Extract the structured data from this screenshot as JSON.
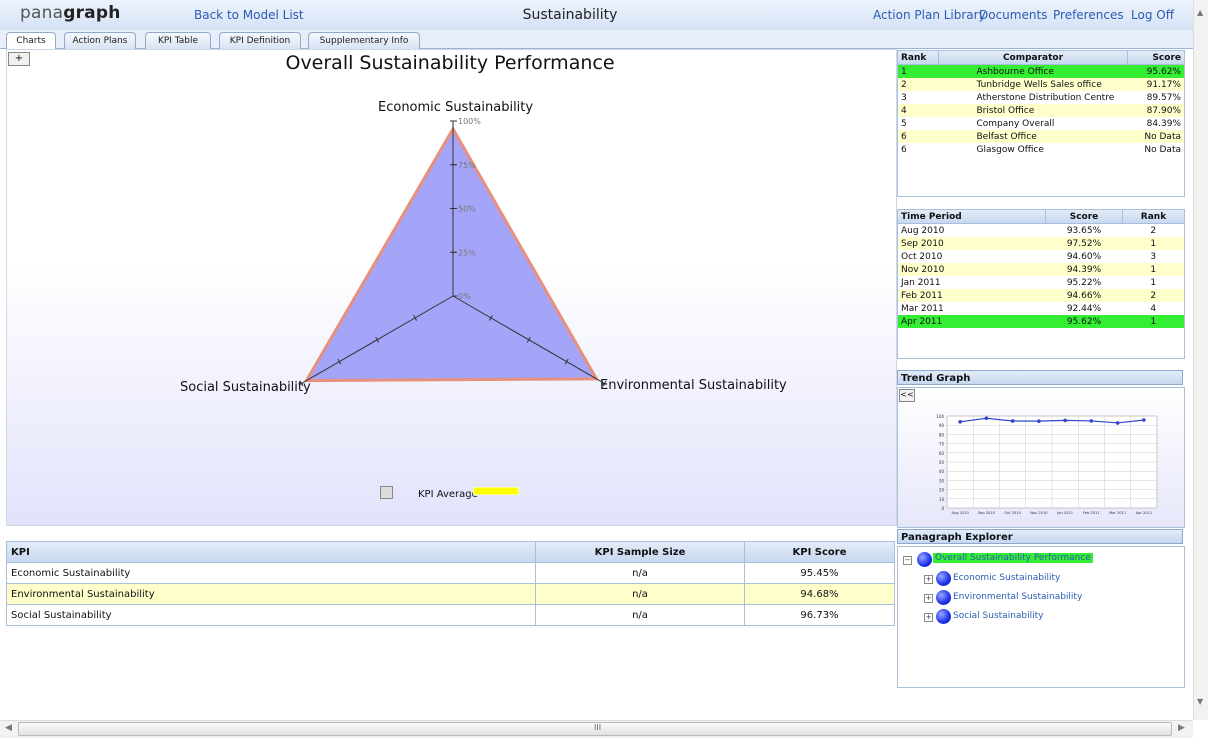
{
  "header": {
    "logo_light": "pana",
    "logo_bold": "graph",
    "back_link": "Back to Model List",
    "title": "Sustainability",
    "links": [
      "Action Plan Library",
      "Documents",
      "Preferences",
      "Log Off"
    ]
  },
  "tabs": [
    "Charts",
    "Action Plans",
    "KPI Table",
    "KPI Definition",
    "Supplementary Info"
  ],
  "chart": {
    "expand_label": "+",
    "title": "Overall Sustainability Performance",
    "legend_label": "KPI Average"
  },
  "chart_data": [
    {
      "type": "radar",
      "title": "Overall Sustainability Performance",
      "axes": [
        "Economic Sustainability",
        "Environmental Sustainability",
        "Social Sustainability"
      ],
      "scale_labels": [
        "0%",
        "25%",
        "50%",
        "75%",
        "100%"
      ],
      "series": [
        {
          "name": "KPI Average",
          "values": [
            95.45,
            94.68,
            96.73
          ]
        }
      ]
    },
    {
      "type": "line",
      "categories": [
        "Aug 2010",
        "Sep 2010",
        "Oct 2010",
        "Nov 2010",
        "Jan 2011",
        "Feb 2011",
        "Mar 2011",
        "Apr 2011"
      ],
      "values": [
        93.65,
        97.52,
        94.6,
        94.39,
        95.22,
        94.66,
        92.44,
        95.62
      ],
      "ylim": [
        0,
        100
      ],
      "yticks": [
        "100",
        "90",
        "80",
        "70",
        "60",
        "50",
        "40",
        "30",
        "20",
        "10",
        "0"
      ]
    }
  ],
  "kpi_table": {
    "headers": [
      "KPI",
      "KPI Sample Size",
      "KPI Score"
    ],
    "rows": [
      {
        "kpi": "Economic Sustainability",
        "sample": "n/a",
        "score": "95.45%"
      },
      {
        "kpi": "Environmental Sustainability",
        "sample": "n/a",
        "score": "94.68%"
      },
      {
        "kpi": "Social Sustainability",
        "sample": "n/a",
        "score": "96.73%"
      }
    ]
  },
  "rank_table": {
    "headers": [
      "Rank",
      "Comparator",
      "Score"
    ],
    "rows": [
      {
        "rank": "1",
        "name": "Ashbourne Office",
        "score": "95.62%"
      },
      {
        "rank": "2",
        "name": "Tunbridge Wells Sales office",
        "score": "91.17%"
      },
      {
        "rank": "3",
        "name": "Atherstone Distribution Centre",
        "score": "89.57%"
      },
      {
        "rank": "4",
        "name": "Bristol Office",
        "score": "87.90%"
      },
      {
        "rank": "5",
        "name": "Company Overall",
        "score": "84.39%"
      },
      {
        "rank": "6",
        "name": "Belfast Office",
        "score": "No Data"
      },
      {
        "rank": "6",
        "name": "Glasgow Office",
        "score": "No Data"
      }
    ]
  },
  "time_table": {
    "headers": [
      "Time Period",
      "Score",
      "Rank"
    ],
    "rows": [
      {
        "period": "Aug 2010",
        "score": "93.65%",
        "rank": "2"
      },
      {
        "period": "Sep 2010",
        "score": "97.52%",
        "rank": "1"
      },
      {
        "period": "Oct 2010",
        "score": "94.60%",
        "rank": "3"
      },
      {
        "period": "Nov 2010",
        "score": "94.39%",
        "rank": "1"
      },
      {
        "period": "Jan 2011",
        "score": "95.22%",
        "rank": "1"
      },
      {
        "period": "Feb 2011",
        "score": "94.66%",
        "rank": "2"
      },
      {
        "period": "Mar 2011",
        "score": "92.44%",
        "rank": "4"
      },
      {
        "period": "Apr 2011",
        "score": "95.62%",
        "rank": "1"
      }
    ]
  },
  "trend": {
    "title": "Trend Graph",
    "collapse_label": "<<"
  },
  "explorer": {
    "title": "Panagraph Explorer",
    "root": "Overall Sustainability Performance",
    "children": [
      "Economic Sustainability",
      "Environmental Sustainability",
      "Social Sustainability"
    ]
  },
  "scrollbar": {
    "grip": "III"
  },
  "colors": {
    "highlight_green": "#33ee33",
    "highlight_yellow": "#ffffcc",
    "radar_fill": "#9f9ff8",
    "radar_stroke": "#e8907e",
    "link_blue": "#2a5db0"
  }
}
